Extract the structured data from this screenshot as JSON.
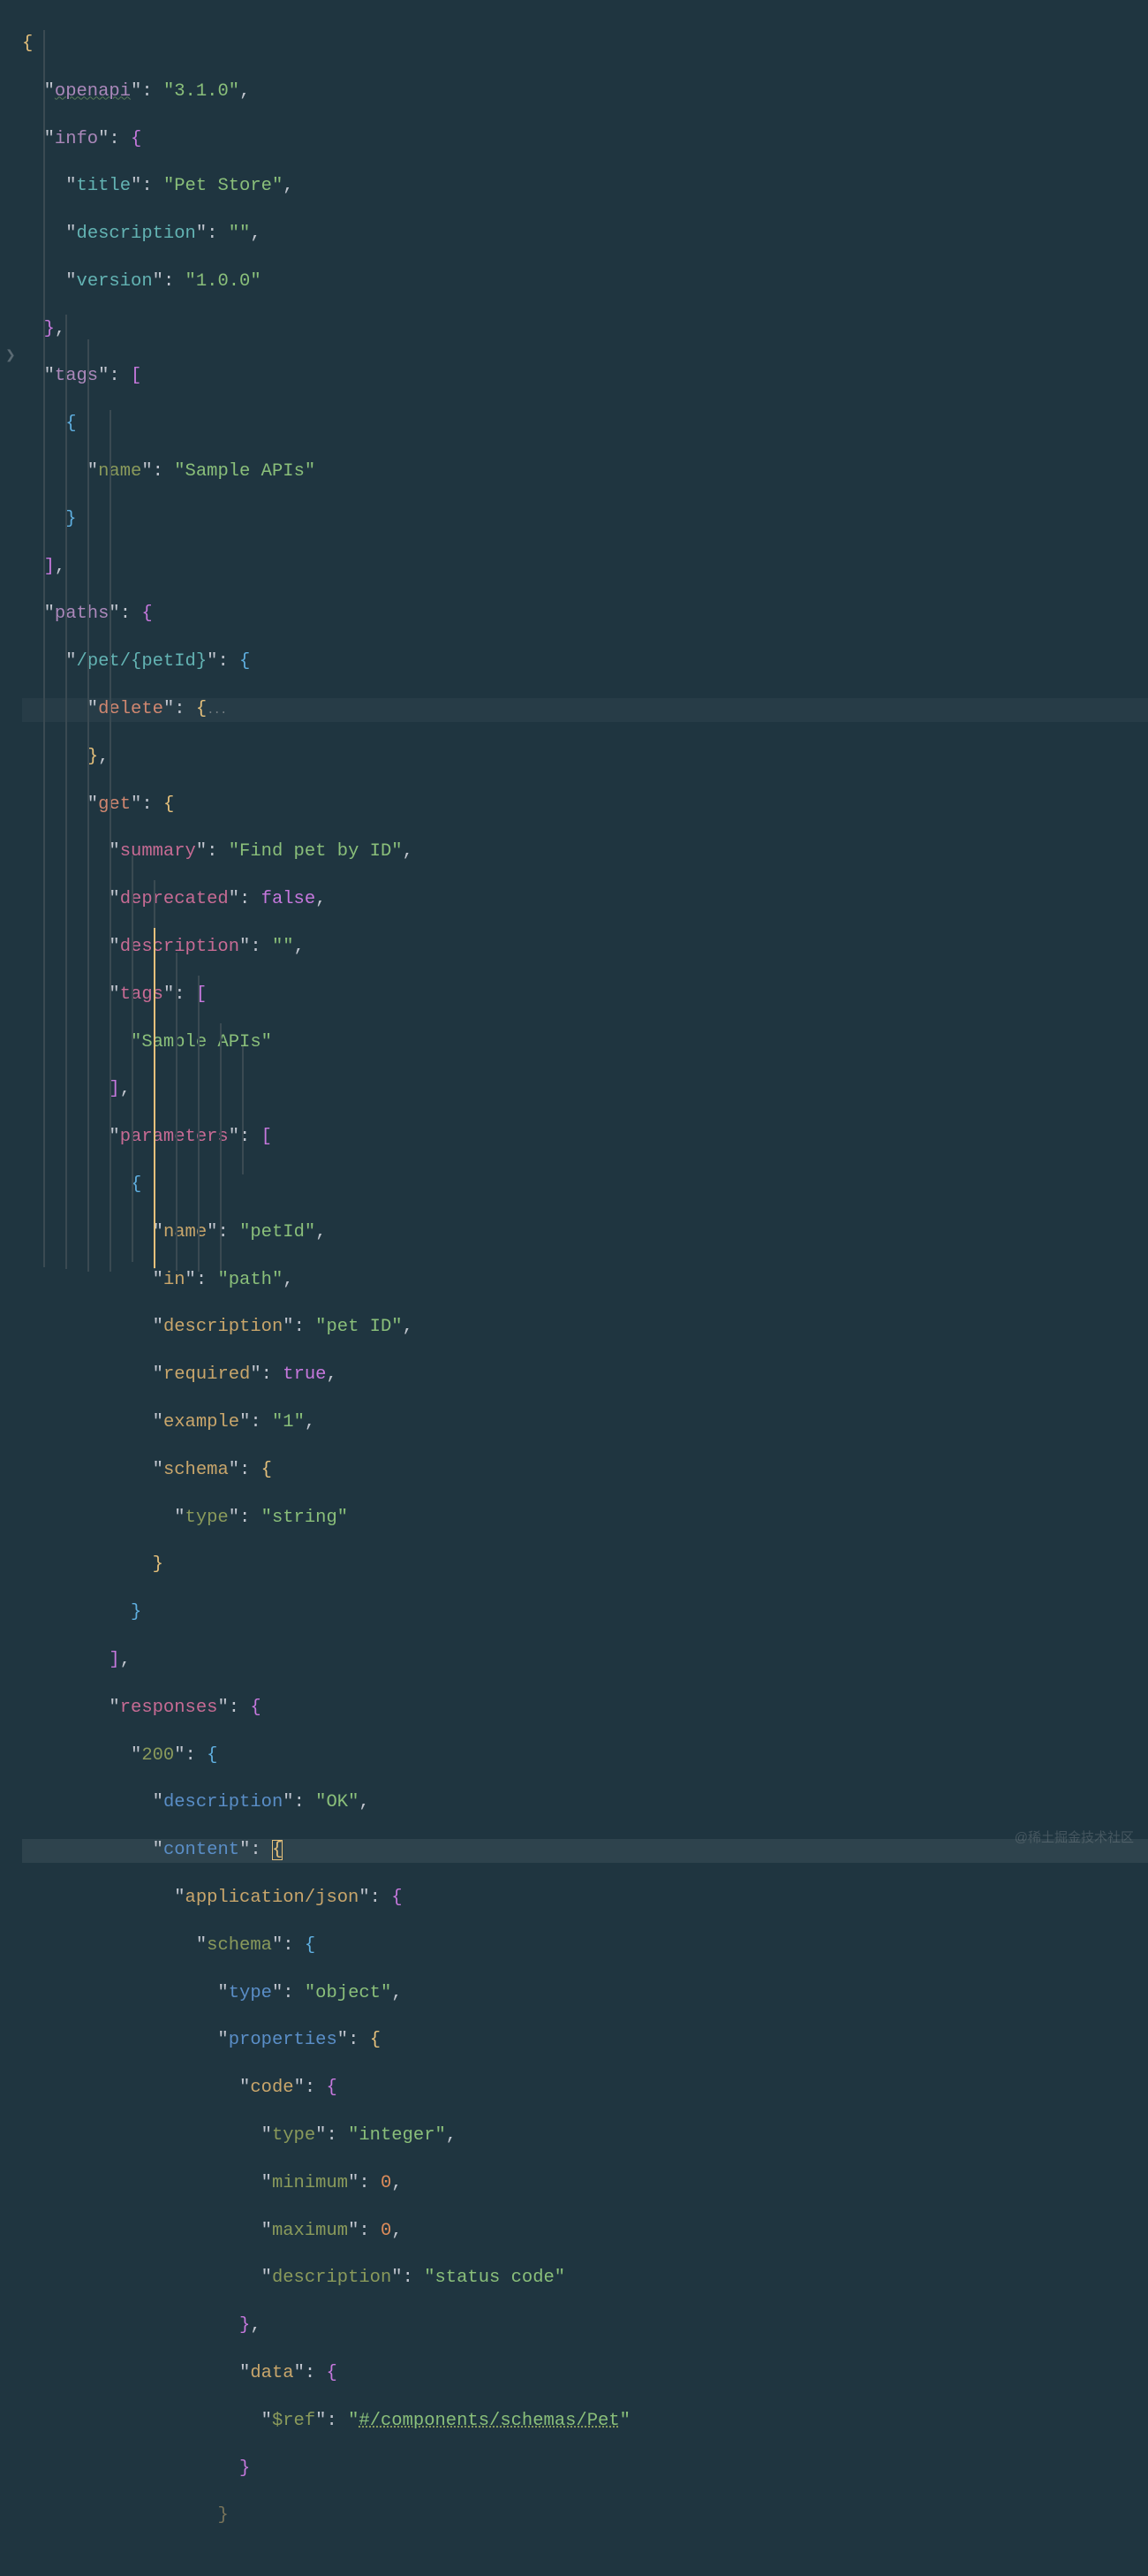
{
  "watermark": "@稀土掘金技术社区",
  "lines": {
    "l1": "{",
    "l2a": "  \"",
    "l2b": "openapi",
    "l2c": "\": ",
    "l2d": "\"3.1.0\"",
    "l2e": ",",
    "l3a": "  \"",
    "l3b": "info",
    "l3c": "\": ",
    "l3d": "{",
    "l4a": "    \"",
    "l4b": "title",
    "l4c": "\": ",
    "l4d": "\"Pet Store\"",
    "l4e": ",",
    "l5a": "    \"",
    "l5b": "description",
    "l5c": "\": ",
    "l5d": "\"\"",
    "l5e": ",",
    "l6a": "    \"",
    "l6b": "version",
    "l6c": "\": ",
    "l6d": "\"1.0.0\"",
    "l7a": "  ",
    "l7b": "}",
    "l7c": ",",
    "l8a": "  \"",
    "l8b": "tags",
    "l8c": "\": ",
    "l8d": "[",
    "l9": "    {",
    "l10a": "      \"",
    "l10b": "name",
    "l10c": "\": ",
    "l10d": "\"Sample APIs\"",
    "l11": "    }",
    "l12a": "  ",
    "l12b": "]",
    "l12c": ",",
    "l13a": "  \"",
    "l13b": "paths",
    "l13c": "\": ",
    "l13d": "{",
    "l14a": "    \"",
    "l14b": "/pet/{petId}",
    "l14c": "\": ",
    "l14d": "{",
    "l15a": "      \"",
    "l15b": "delete",
    "l15c": "\": ",
    "l15d": "{",
    "l15e": "...",
    "l16a": "      ",
    "l16b": "}",
    "l16c": ",",
    "l17a": "      \"",
    "l17b": "get",
    "l17c": "\": ",
    "l17d": "{",
    "l18a": "        \"",
    "l18b": "summary",
    "l18c": "\": ",
    "l18d": "\"Find pet by ID\"",
    "l18e": ",",
    "l19a": "        \"",
    "l19b": "deprecated",
    "l19c": "\": ",
    "l19d": "false",
    "l19e": ",",
    "l20a": "        \"",
    "l20b": "description",
    "l20c": "\": ",
    "l20d": "\"\"",
    "l20e": ",",
    "l21a": "        \"",
    "l21b": "tags",
    "l21c": "\": ",
    "l21d": "[",
    "l22a": "          ",
    "l22b": "\"Sample APIs\"",
    "l23a": "        ",
    "l23b": "]",
    "l23c": ",",
    "l24a": "        \"",
    "l24b": "parameters",
    "l24c": "\": ",
    "l24d": "[",
    "l25a": "          ",
    "l25b": "{",
    "l26a": "            \"",
    "l26b": "name",
    "l26c": "\": ",
    "l26d": "\"petId\"",
    "l26e": ",",
    "l27a": "            \"",
    "l27b": "in",
    "l27c": "\": ",
    "l27d": "\"path\"",
    "l27e": ",",
    "l28a": "            \"",
    "l28b": "description",
    "l28c": "\": ",
    "l28d": "\"pet ID\"",
    "l28e": ",",
    "l29a": "            \"",
    "l29b": "required",
    "l29c": "\": ",
    "l29d": "true",
    "l29e": ",",
    "l30a": "            \"",
    "l30b": "example",
    "l30c": "\": ",
    "l30d": "\"1\"",
    "l30e": ",",
    "l31a": "            \"",
    "l31b": "schema",
    "l31c": "\": ",
    "l31d": "{",
    "l32a": "              \"",
    "l32b": "type",
    "l32c": "\": ",
    "l32d": "\"string\"",
    "l33a": "            ",
    "l33b": "}",
    "l34a": "          ",
    "l34b": "}",
    "l35a": "        ",
    "l35b": "]",
    "l35c": ",",
    "l36a": "        \"",
    "l36b": "responses",
    "l36c": "\": ",
    "l36d": "{",
    "l37a": "          \"",
    "l37b": "200",
    "l37c": "\": ",
    "l37d": "{",
    "l38a": "            \"",
    "l38b": "description",
    "l38c": "\": ",
    "l38d": "\"OK\"",
    "l38e": ",",
    "l39a": "            \"",
    "l39b": "content",
    "l39c": "\": ",
    "l39d": "{",
    "l40a": "              \"",
    "l40b": "application/json",
    "l40c": "\": ",
    "l40d": "{",
    "l41a": "                \"",
    "l41b": "schema",
    "l41c": "\": ",
    "l41d": "{",
    "l42a": "                  \"",
    "l42b": "type",
    "l42c": "\": ",
    "l42d": "\"object\"",
    "l42e": ",",
    "l43a": "                  \"",
    "l43b": "properties",
    "l43c": "\": ",
    "l43d": "{",
    "l44a": "                    \"",
    "l44b": "code",
    "l44c": "\": ",
    "l44d": "{",
    "l45a": "                      \"",
    "l45b": "type",
    "l45c": "\": ",
    "l45d": "\"integer\"",
    "l45e": ",",
    "l46a": "                      \"",
    "l46b": "minimum",
    "l46c": "\": ",
    "l46d": "0",
    "l46e": ",",
    "l47a": "                      \"",
    "l47b": "maximum",
    "l47c": "\": ",
    "l47d": "0",
    "l47e": ",",
    "l48a": "                      \"",
    "l48b": "description",
    "l48c": "\": ",
    "l48d": "\"status code\"",
    "l49a": "                    ",
    "l49b": "}",
    "l49c": ",",
    "l50a": "                    \"",
    "l50b": "data",
    "l50c": "\": ",
    "l50d": "{",
    "l51a": "                      \"",
    "l51b": "$ref",
    "l51c": "\": ",
    "l51d": "\"",
    "l51e": "#/components/schemas/Pet",
    "l51f": "\"",
    "l52a": "                    ",
    "l52b": "}",
    "l53a": "                  ",
    "l53b": "}"
  }
}
